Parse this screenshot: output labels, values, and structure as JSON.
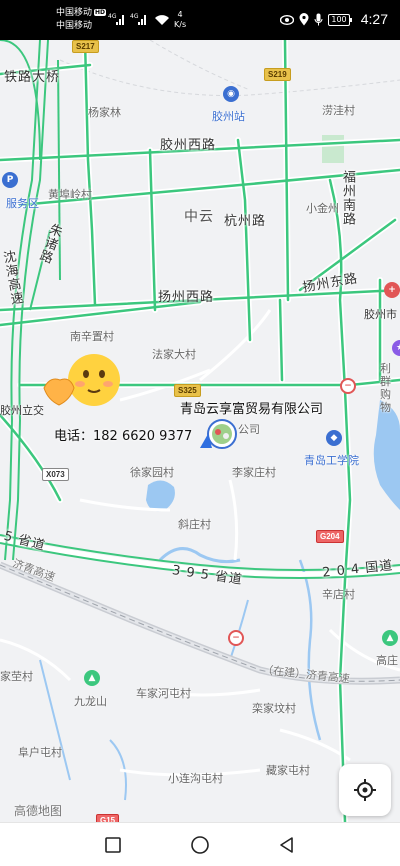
{
  "status_bar": {
    "carrier_1": "中国移动",
    "carrier_2": "中国移动",
    "hd_badge": "HD",
    "signal_1_tag": "4G",
    "signal_2_tag": "4G",
    "speed_value": "4",
    "speed_unit": "K/s",
    "battery": "100",
    "time": "4:27",
    "icons": [
      "eye-icon",
      "location-icon",
      "mic-icon",
      "battery-icon"
    ]
  },
  "map": {
    "road_names": [
      "铁路大桥",
      "胶州西路",
      "杭州路",
      "扬州西路",
      "扬州东路",
      "福州南路",
      "沈海高速",
      "朱诸路",
      "3 9 5 省道",
      "2 0 4 国道",
      "5 省道",
      "济青高速",
      "（在建）济青高速"
    ],
    "place_names": [
      "杨家林",
      "胶州站",
      "涝洼村",
      "黄埠岭村",
      "小金州",
      "中云",
      "南辛置村",
      "法家大村",
      "胶州市",
      "利群购物",
      "胶州立交",
      "公司",
      "徐家园村",
      "李家庄村",
      "青岛工学院",
      "斜庄村",
      "辛店村",
      "家茔村",
      "九龙山",
      "车家河屯村",
      "栾家坟村",
      "高庄",
      "阜户屯村",
      "小连沟屯村",
      "藏家屯村",
      "服务区"
    ],
    "shields": [
      "S217",
      "S219",
      "S325",
      "G204",
      "X073",
      "G15"
    ],
    "company_name": "青岛云享富贸易有限公司",
    "phone_label": "电话：",
    "phone_number": "182 6620 9377",
    "logo": "高德地图",
    "colors": {
      "road_green": "#3cc77e",
      "road_casing": "#ffffff",
      "water": "#9cc8f2",
      "park": "#c9e9cf",
      "background": "#f1f2f4"
    }
  },
  "nav_bar": {
    "buttons": [
      "recents-square-icon",
      "home-circle-icon",
      "back-triangle-icon"
    ]
  }
}
